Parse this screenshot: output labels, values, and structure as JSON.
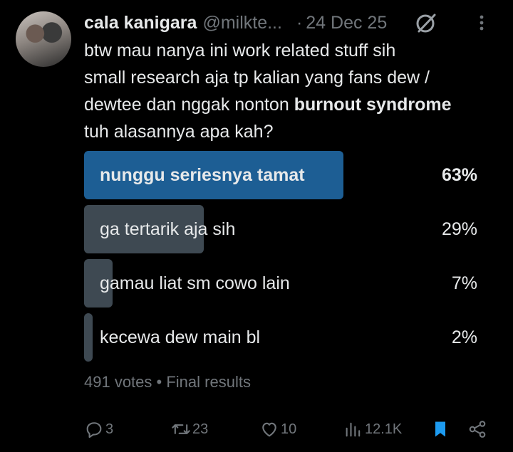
{
  "tweet": {
    "display_name": "cala kanigara",
    "handle": "@milkte...",
    "separator": "·",
    "date": "24 Dec 25",
    "text_line1": "btw mau nanya ini work related stuff sih",
    "text_line2": "small research aja tp kalian yang fans dew /",
    "text_line3_start": "dewtee dan nggak nonton ",
    "text_line3_bold": "burnout syndrome",
    "text_line4": "tuh alasannya apa kah?"
  },
  "poll": {
    "options": [
      {
        "label": "nunggu seriesnya tamat",
        "percent_text": "63%",
        "percent": 63,
        "winner": true
      },
      {
        "label": "ga tertarik aja sih",
        "percent_text": "29%",
        "percent": 29,
        "winner": false
      },
      {
        "label": "gamau liat sm cowo lain",
        "percent_text": "7%",
        "percent": 7,
        "winner": false
      },
      {
        "label": "kecewa dew main bl",
        "percent_text": "2%",
        "percent": 2,
        "winner": false
      }
    ],
    "votes": "491 votes",
    "meta_separator": "•",
    "status": "Final results"
  },
  "actions": {
    "replies": "3",
    "reposts": "23",
    "likes": "10",
    "views": "12.1K"
  },
  "colors": {
    "background": "#000000",
    "text": "#e7e9ea",
    "muted": "#71767b",
    "winner_bar": "#1d5e94",
    "bar": "#3e4952",
    "bookmark": "#1d9bf0"
  },
  "icons": [
    "grok-icon",
    "more-icon",
    "reply-icon",
    "repost-icon",
    "like-icon",
    "views-icon",
    "bookmark-icon",
    "share-icon"
  ]
}
